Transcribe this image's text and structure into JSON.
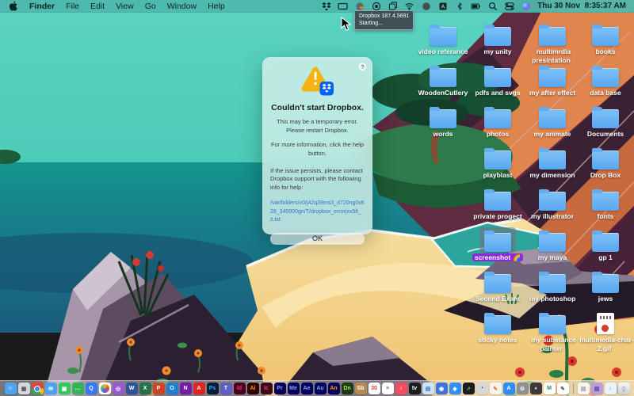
{
  "menu_bar": {
    "menus": [
      "Finder",
      "File",
      "Edit",
      "View",
      "Go",
      "Window",
      "Help"
    ],
    "status_icons": [
      "dropbox-status",
      "screen-mirroring",
      "color-meter",
      "screen-record",
      "copy-stack",
      "wifi",
      "github",
      "input-source-a",
      "bluetooth",
      "battery",
      "spotlight",
      "control-center",
      "siri"
    ],
    "clock": "Thu 30 Nov  8:35:37 AM"
  },
  "tooltip": {
    "title": "Dropbox 187.4.5691",
    "subtitle": "Starting..."
  },
  "dialog": {
    "help": "?",
    "title": "Couldn't start Dropbox.",
    "paragraph1": "This may be a temporary error. Please restart Dropbox.",
    "paragraph2": "For more information, click the help button.",
    "paragraph3": "If the issue persists, please contact Dropbox support with the following info for help:",
    "link": "/var/folders/v0/j42q39ms3_d720ng0x628_340000gn/T/dropbox_errorjxx5lt_z.txt",
    "ok": "OK"
  },
  "desktop": {
    "icons": [
      {
        "label": "video referance",
        "col": 0,
        "row": 1,
        "type": "folder"
      },
      {
        "label": "my unity",
        "col": 1,
        "row": 1,
        "type": "folder"
      },
      {
        "label": "multimrdia presintation",
        "col": 2,
        "row": 1,
        "type": "folder"
      },
      {
        "label": "books",
        "col": 3,
        "row": 1,
        "type": "folder"
      },
      {
        "label": "WoodenCutlery",
        "col": 0,
        "row": 2,
        "type": "folder"
      },
      {
        "label": "pdfs and svgs",
        "col": 1,
        "row": 2,
        "type": "folder"
      },
      {
        "label": "my after effect",
        "col": 2,
        "row": 2,
        "type": "folder"
      },
      {
        "label": "data base",
        "col": 3,
        "row": 2,
        "type": "folder"
      },
      {
        "label": "words",
        "col": 0,
        "row": 3,
        "type": "folder"
      },
      {
        "label": "photos",
        "col": 1,
        "row": 3,
        "type": "folder"
      },
      {
        "label": "my animate",
        "col": 2,
        "row": 3,
        "type": "folder"
      },
      {
        "label": "Documents",
        "col": 3,
        "row": 3,
        "type": "folder"
      },
      {
        "label": "playblast",
        "col": 1,
        "row": 4,
        "type": "folder"
      },
      {
        "label": "my dimension",
        "col": 2,
        "row": 4,
        "type": "folder"
      },
      {
        "label": "Drop Box",
        "col": 3,
        "row": 4,
        "type": "folder"
      },
      {
        "label": "private progect",
        "col": 1,
        "row": 5,
        "type": "folder"
      },
      {
        "label": "my illustrator",
        "col": 2,
        "row": 5,
        "type": "folder"
      },
      {
        "label": "fonts",
        "col": 3,
        "row": 5,
        "type": "folder"
      },
      {
        "label": "screenshot 🌈",
        "col": 1,
        "row": 6,
        "type": "folder",
        "selected": true
      },
      {
        "label": "my maya",
        "col": 2,
        "row": 6,
        "type": "folder"
      },
      {
        "label": "gp 1",
        "col": 3,
        "row": 6,
        "type": "folder"
      },
      {
        "label": "Second Exam",
        "col": 1,
        "row": 7,
        "type": "folder"
      },
      {
        "label": "my photoshop",
        "col": 2,
        "row": 7,
        "type": "folder"
      },
      {
        "label": "jews",
        "col": 3,
        "row": 7,
        "type": "folder"
      },
      {
        "label": "sticky notes",
        "col": 1,
        "row": 8,
        "type": "folder"
      },
      {
        "label": "my substance painter",
        "col": 2,
        "row": 8,
        "type": "folder"
      },
      {
        "label": "multimedia-char-2.gif",
        "col": 3,
        "row": 8,
        "type": "file"
      }
    ]
  },
  "dock": {
    "items": [
      {
        "name": "finder",
        "glyph": "☺",
        "bg": "#4ea3f7",
        "fg": "#fff"
      },
      {
        "name": "launchpad",
        "glyph": "▦",
        "bg": "#d4d8de",
        "fg": "#555"
      },
      {
        "name": "chrome",
        "cls": "chrome"
      },
      {
        "name": "mail",
        "glyph": "✉",
        "bg": "#4aa3f0",
        "fg": "#fff"
      },
      {
        "name": "facetime",
        "glyph": "▣",
        "bg": "#34c759",
        "fg": "#fff"
      },
      {
        "name": "messages",
        "glyph": "…",
        "bg": "#30b456",
        "fg": "#fff"
      },
      {
        "name": "quicktime",
        "glyph": "Q",
        "bg": "#3478f6",
        "fg": "#fff"
      },
      {
        "name": "photos",
        "cls": "photos"
      },
      {
        "name": "photo-booth",
        "glyph": "◎",
        "bg": "#9b59d0",
        "fg": "#fff"
      },
      {
        "name": "word",
        "glyph": "W",
        "bg": "#2b579a",
        "fg": "#fff"
      },
      {
        "name": "excel",
        "glyph": "X",
        "bg": "#217346",
        "fg": "#fff"
      },
      {
        "name": "powerpoint",
        "glyph": "P",
        "bg": "#d04423",
        "fg": "#fff"
      },
      {
        "name": "outlook",
        "glyph": "O",
        "bg": "#1b7fd4",
        "fg": "#fff"
      },
      {
        "name": "onenote",
        "glyph": "N",
        "bg": "#7719aa",
        "fg": "#fff"
      },
      {
        "name": "acrobat",
        "glyph": "A",
        "bg": "#e2241a",
        "fg": "#fff"
      },
      {
        "name": "photoshop",
        "glyph": "Ps",
        "bg": "#001e36",
        "fg": "#31a8ff"
      },
      {
        "name": "teams",
        "glyph": "T",
        "bg": "#5b5fc7",
        "fg": "#fff"
      },
      {
        "name": "indesign",
        "glyph": "Id",
        "bg": "#49021f",
        "fg": "#ff3366"
      },
      {
        "name": "illustrator",
        "glyph": "Ai",
        "bg": "#330000",
        "fg": "#ff9a00"
      },
      {
        "name": "incopy",
        "glyph": "Ic",
        "bg": "#3a0c1e",
        "fg": "#ff3366"
      },
      {
        "name": "premiere",
        "glyph": "Pr",
        "bg": "#00005b",
        "fg": "#9999ff"
      },
      {
        "name": "media-encoder",
        "glyph": "Me",
        "bg": "#00005b",
        "fg": "#9999ff"
      },
      {
        "name": "after-effects",
        "glyph": "Ae",
        "bg": "#00005b",
        "fg": "#9999ff"
      },
      {
        "name": "audition",
        "glyph": "Au",
        "bg": "#00005b",
        "fg": "#9999ff"
      },
      {
        "name": "animate",
        "glyph": "An",
        "bg": "#00005b",
        "fg": "#ff9a00"
      },
      {
        "name": "dimension",
        "glyph": "Dn",
        "bg": "#1d3a0f",
        "fg": "#9fe870"
      },
      {
        "name": "substance-3d",
        "glyph": "Sb",
        "bg": "#b98a4f",
        "fg": "#fff"
      },
      {
        "name": "calendar",
        "glyph": "30",
        "bg": "#ffffff",
        "fg": "#e0382e"
      },
      {
        "name": "reminders",
        "glyph": "≡",
        "bg": "#ffffff",
        "fg": "#555"
      },
      {
        "name": "music",
        "glyph": "♪",
        "bg": "#fa4b63",
        "fg": "#fff"
      },
      {
        "name": "tv",
        "glyph": "tv",
        "bg": "#1c1c1e",
        "fg": "#fff"
      },
      {
        "name": "files",
        "glyph": "▤",
        "bg": "#cfe3f7",
        "fg": "#2b7de0"
      },
      {
        "name": "globe",
        "glyph": "◉",
        "bg": "#3f73e0",
        "fg": "#fff"
      },
      {
        "name": "safari",
        "glyph": "◈",
        "bg": "#2f8ef5",
        "fg": "#fff"
      },
      {
        "name": "stocks",
        "glyph": "↗",
        "bg": "#1c1c1e",
        "fg": "#34c759"
      },
      {
        "name": "clock",
        "glyph": "◔",
        "bg": "#d8d8dc",
        "fg": "#333"
      },
      {
        "name": "textedit",
        "glyph": "✎",
        "bg": "#f5f5f0",
        "fg": "#e67e22"
      },
      {
        "name": "app-store",
        "glyph": "A",
        "bg": "#2f8ef5",
        "fg": "#fff"
      },
      {
        "name": "system-settings",
        "glyph": "⚙",
        "bg": "#8e8e93",
        "fg": "#f2f2f2"
      },
      {
        "name": "dark-sphere",
        "glyph": "◕",
        "bg": "#3a3a3c",
        "fg": "#ddd"
      },
      {
        "name": "m-app",
        "glyph": "M",
        "bg": "#ffffff",
        "fg": "#2e8b57"
      },
      {
        "name": "notes-pencil",
        "glyph": "✎",
        "bg": "#ffffff",
        "fg": "#555"
      },
      {
        "name": "divider",
        "type": "divider"
      },
      {
        "name": "document",
        "glyph": "▤",
        "bg": "#f5f5f7",
        "fg": "#999"
      },
      {
        "name": "stack",
        "glyph": "▤",
        "bg": "#b9a0d8",
        "fg": "#5e3a8e"
      },
      {
        "name": "downloads",
        "glyph": "↓",
        "bg": "#eaf2fb",
        "fg": "#2b7de0"
      },
      {
        "name": "trash",
        "glyph": "▯",
        "cls": "trash"
      }
    ]
  },
  "colors": {
    "menubar_teal": "#4db8ad",
    "dropbox_blue": "#0061fe",
    "warning_yellow": "#f6b313",
    "selection_purple": "#8a2bd9",
    "folder_blue": "#64aef3",
    "link_blue": "#2f77d6"
  }
}
